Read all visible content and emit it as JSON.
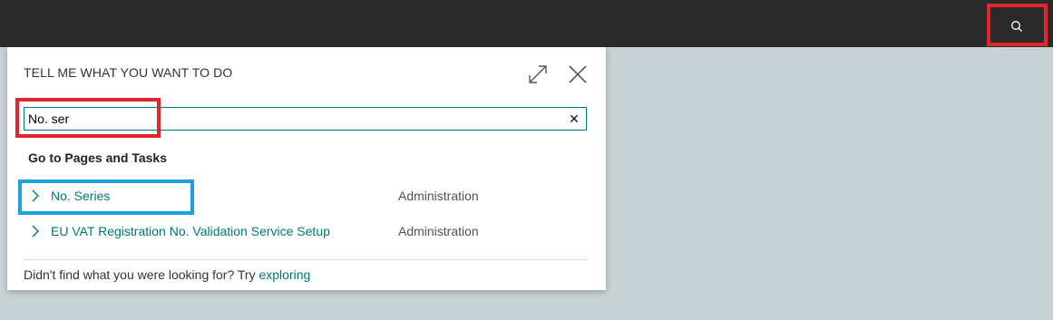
{
  "topbar": {
    "search_icon": "search-icon"
  },
  "dialog": {
    "title": "TELL ME WHAT YOU WANT TO DO",
    "expand_icon": "expand-icon",
    "close_icon": "close-icon",
    "search": {
      "value": "No. ser",
      "clear_icon": "clear-icon",
      "clear_glyph": "✕"
    },
    "section_title": "Go to Pages and Tasks",
    "results": [
      {
        "label": "No. Series",
        "category": "Administration"
      },
      {
        "label": "EU VAT Registration No. Validation Service Setup",
        "category": "Administration"
      }
    ],
    "footer": {
      "text": "Didn't find what you were looking for? Try ",
      "link": "exploring"
    }
  },
  "colors": {
    "topbar": "#2a2a2a",
    "background": "#c8d1d3",
    "accent": "#00787a",
    "highlight_red": "#e0262d",
    "highlight_blue": "#1da1e3"
  }
}
